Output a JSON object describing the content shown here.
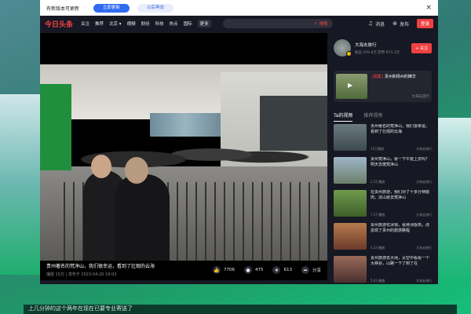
{
  "titlebar": {
    "title": "有新版本可更新",
    "primary_button": "立即更新",
    "secondary_button": "以后再说",
    "close": "×"
  },
  "nav": {
    "logo": "今日头条",
    "items": [
      "关注",
      "推荐",
      "北京 ▾",
      "视频",
      "财经",
      "科技",
      "热点",
      "国际",
      "更多"
    ],
    "search_label": "搜索",
    "messages": "消息",
    "publish": "发布",
    "login": "登录"
  },
  "video": {
    "title": "贵州著名的梵净山，我们很幸运，看到了壮观的云海",
    "meta": "播放 15万 | 发布于 2023-04-20 19:03",
    "actions": {
      "likes": "7706",
      "comments": "475",
      "favorites": "613",
      "share": "分享"
    }
  },
  "author": {
    "name": "大海去旅行",
    "stats": "粉丝 109.8万  获赞 673.1万",
    "follow": "+ 关注"
  },
  "promo": {
    "tag": "[图集]",
    "title": "贵州和扬州的精华",
    "author": "大海去旅行"
  },
  "tabs": [
    "Ta的视频",
    "推荐视频"
  ],
  "list": [
    {
      "title": "贵州著名的梵净山，我们很幸运，看到了壮观的云海",
      "views": "15万播放",
      "author": "大海去旅行",
      "duration": "",
      "color": "#6a7a7f"
    },
    {
      "title": "贵州梵净山，就一下午能上去吗？明天去爬梵净山",
      "views": "2.3万播放",
      "author": "大海去旅行",
      "duration": "",
      "color": "#7f8f9a"
    },
    {
      "title": "在贵州旅游，我们对了十多分钟腊肉，凉山就去梵净山",
      "views": "7.2万播放",
      "author": "大海去旅行",
      "duration": "",
      "color": "#4f7a3d"
    },
    {
      "title": "贵州旅游花冰锅，看钟汤饭热，改造现了贵州的旅游路程",
      "views": "4.2万播放",
      "author": "大海去旅行",
      "duration": "",
      "color": "#a05a3a"
    },
    {
      "title": "贵州旅游去大场，从空中看看一个大峡谷，山路一下了到了在",
      "views": "5.6万播放",
      "author": "大海去旅行",
      "duration": "",
      "color": "#7a4a4a"
    }
  ],
  "bottom_text": "上几分钟的这个两年在现在已要专业寄送了"
}
